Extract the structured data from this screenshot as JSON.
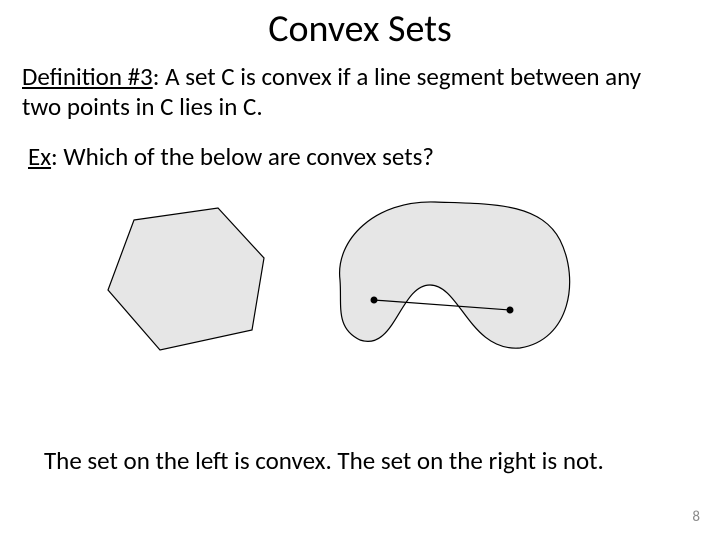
{
  "title": "Convex Sets",
  "definition": {
    "label": "Definition #3",
    "text": ": A set C is convex if a line segment between any two points in C lies in C."
  },
  "example": {
    "label": "Ex",
    "text": ": Which of the below are convex sets?"
  },
  "answer": "The set on the left is convex. The set on the right is not.",
  "page_number": "8"
}
